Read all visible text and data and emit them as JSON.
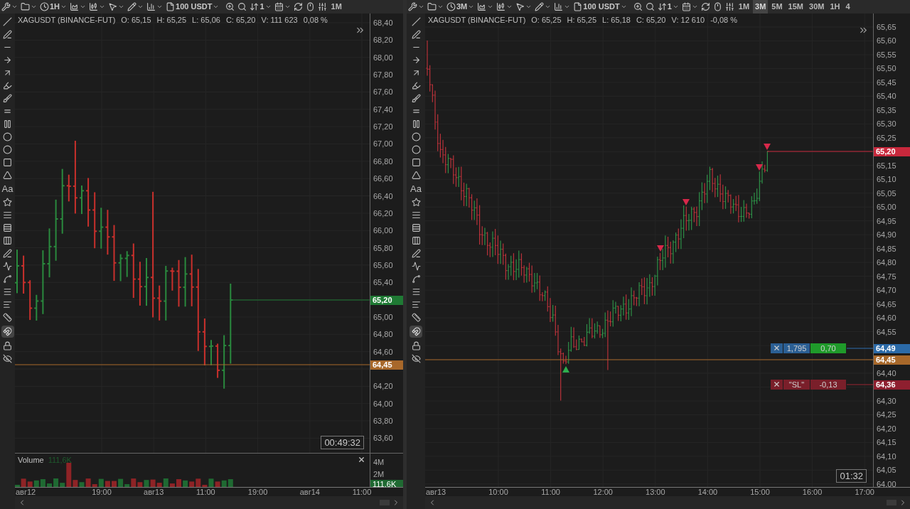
{
  "panels": [
    {
      "toolbar": {
        "chart_interval": "1H",
        "order_size": "100 USDT",
        "order_count": "1",
        "intervals": [
          {
            "label": "1M",
            "selected": false
          }
        ]
      },
      "text_tool_glyph": "Aa",
      "magnet_on": true,
      "legend": {
        "symbol": "XAGUSDT (BINANCE-FUT)",
        "open": "O: 65,15",
        "high": "H: 65,25",
        "low": "L: 65,06",
        "close": "C: 65,20",
        "volume": "V: 111 623",
        "change": "0,08 %"
      },
      "price_axis": [
        "68,40",
        "68,20",
        "68,00",
        "67,80",
        "67,60",
        "67,40",
        "67,20",
        "67,00",
        "66,80",
        "66,60",
        "66,40",
        "66,20",
        "66,00",
        "65,80",
        "65,60",
        "65,40",
        "65,00",
        "64,80",
        "64,60",
        "64,20",
        "64,00",
        "63,80",
        "63,60"
      ],
      "price_tags": [
        {
          "kind": "last",
          "text": "65,20",
          "color": "#1f7a34"
        },
        {
          "kind": "level",
          "text": "64,45",
          "color": "#a8682a"
        }
      ],
      "countdown": "00:49:32",
      "volume": {
        "label": "Volume",
        "value": "111,6K",
        "axis": [
          "4M",
          "2M"
        ],
        "last": "111,6K"
      },
      "time_axis": [
        "авг12",
        "19:00",
        "авг13",
        "11:00",
        "19:00",
        "авг14",
        "11:00"
      ]
    },
    {
      "toolbar": {
        "chart_interval": "3M",
        "order_size": "100 USDT",
        "order_count": "1",
        "intervals": [
          {
            "label": "1M",
            "selected": false
          },
          {
            "label": "3M",
            "selected": true
          },
          {
            "label": "5M",
            "selected": false
          },
          {
            "label": "15M",
            "selected": false
          },
          {
            "label": "30M",
            "selected": false
          },
          {
            "label": "1H",
            "selected": false
          },
          {
            "label": "4",
            "selected": false
          }
        ]
      },
      "text_tool_glyph": "Aa",
      "magnet_on": true,
      "legend": {
        "symbol": "XAGUSDT (BINANCE-FUT)",
        "open": "O: 65,25",
        "high": "H: 65,25",
        "low": "L: 65,18",
        "close": "C: 65,20",
        "volume": "V: 12 610",
        "change": "-0,08 %"
      },
      "price_axis": [
        "65,65",
        "65,60",
        "65,55",
        "65,50",
        "65,45",
        "65,40",
        "65,35",
        "65,30",
        "65,25",
        "65,15",
        "65,10",
        "65,05",
        "65,00",
        "64,95",
        "64,90",
        "64,85",
        "64,80",
        "64,75",
        "64,70",
        "64,65",
        "64,60",
        "64,55",
        "64,40",
        "64,30",
        "64,25",
        "64,20",
        "64,15",
        "64,10",
        "64,05",
        "64,00"
      ],
      "price_tags": [
        {
          "kind": "last",
          "text": "65,20",
          "color": "#c8283c"
        },
        {
          "kind": "level",
          "text": "64,45",
          "color": "#a8682a"
        }
      ],
      "orders": [
        {
          "kind": "position",
          "qty": "1,795",
          "pnl": "0,70",
          "price": "64,49"
        },
        {
          "kind": "stop",
          "qty": "\"SL\"",
          "pnl": "-0,13",
          "price": "64,36"
        }
      ],
      "countdown": "01:32",
      "time_axis": [
        "авг13",
        "10:00",
        "11:00",
        "12:00",
        "13:00",
        "14:00",
        "15:00",
        "16:00",
        "17:00"
      ]
    }
  ]
}
